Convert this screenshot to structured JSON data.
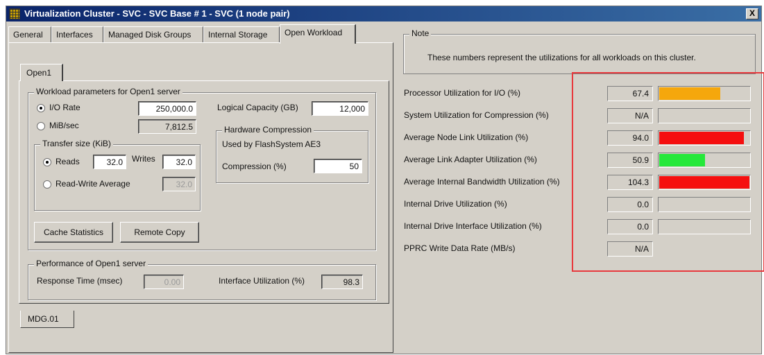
{
  "window": {
    "title": "Virtualization Cluster - SVC - SVC Base # 1 - SVC (1 node pair)",
    "close_label": "X"
  },
  "tabs": [
    {
      "label": "General"
    },
    {
      "label": "Interfaces"
    },
    {
      "label": "Managed Disk Groups"
    },
    {
      "label": "Internal Storage"
    },
    {
      "label": "Open Workload",
      "active": true
    }
  ],
  "sub_tab": "Open1",
  "workload": {
    "group_title": "Workload parameters for Open1 server",
    "io_rate_label": "I/O Rate",
    "io_rate_value": "250,000.0",
    "io_rate_selected": true,
    "mib_label": "MiB/sec",
    "mib_value": "7,812.5",
    "logical_capacity_label": "Logical Capacity (GB)",
    "logical_capacity_value": "12,000",
    "transfer": {
      "group_title": "Transfer size (KiB)",
      "reads_label": "Reads",
      "reads_value": "32.0",
      "writes_label": "Writes",
      "writes_value": "32.0",
      "rw_avg_label": "Read-Write Average",
      "rw_avg_value": "32.0",
      "reads_selected": true
    },
    "hw_compression": {
      "group_title": "Hardware Compression",
      "used_by": "Used by FlashSystem AE3",
      "compression_label": "Compression (%)",
      "compression_value": "50"
    },
    "cache_stats_button": "Cache Statistics",
    "remote_copy_button": "Remote Copy"
  },
  "performance": {
    "group_title": "Performance of Open1 server",
    "response_time_label": "Response Time (msec)",
    "response_time_value": "0.00",
    "interface_util_label": "Interface Utilization (%)",
    "interface_util_value": "98.3"
  },
  "bottom_tab": "MDG.01",
  "note": {
    "title": "Note",
    "text": "These numbers represent the utilizations for all workloads on this cluster."
  },
  "colors": {
    "orange": "#f5a70c",
    "red": "#f50f0f",
    "green": "#25e83a",
    "highlight": "#e8393d"
  },
  "metrics": [
    {
      "label": "Processor Utilization for I/O (%)",
      "value": "67.4",
      "level": 0.674,
      "color": "#f5a70c",
      "bar": true
    },
    {
      "label": "System Utilization for Compression (%)",
      "value": "N/A",
      "level": 0,
      "color": "",
      "bar": true
    },
    {
      "label": "Average Node Link Utilization (%)",
      "value": "94.0",
      "level": 0.94,
      "color": "#f50f0f",
      "bar": true
    },
    {
      "label": "Average Link Adapter Utilization (%)",
      "value": "50.9",
      "level": 0.509,
      "color": "#25e83a",
      "bar": true
    },
    {
      "label": "Average Internal Bandwidth Utilization (%)",
      "value": "104.3",
      "level": 1.0,
      "color": "#f50f0f",
      "bar": true
    },
    {
      "label": "Internal Drive Utilization (%)",
      "value": "0.0",
      "level": 0,
      "color": "",
      "bar": true
    },
    {
      "label": "Internal Drive Interface Utilization (%)",
      "value": "0.0",
      "level": 0,
      "color": "",
      "bar": true
    },
    {
      "label": "PPRC Write Data Rate (MB/s)",
      "value": "N/A",
      "level": 0,
      "color": "",
      "bar": false
    }
  ]
}
